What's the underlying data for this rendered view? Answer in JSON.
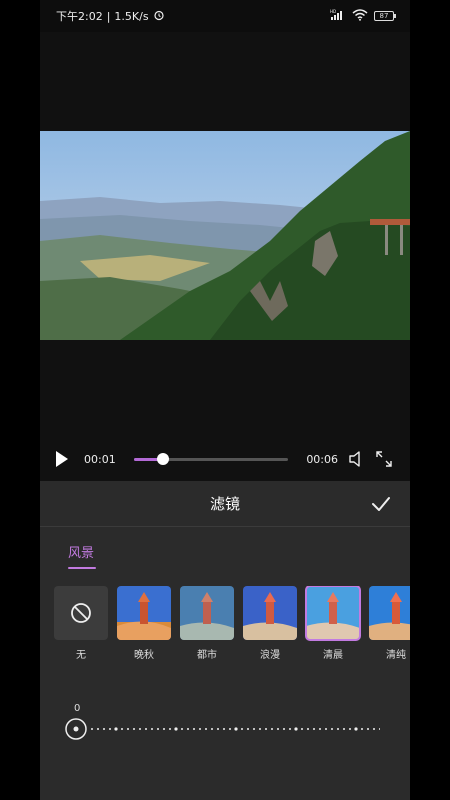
{
  "status_bar": {
    "time": "下午2:02",
    "speed": "1.5K/s",
    "network": "HD",
    "battery": "87"
  },
  "player": {
    "current_time": "00:01",
    "duration": "00:06",
    "progress": 0.19
  },
  "panel": {
    "title": "滤镜",
    "tab": "风景",
    "filters": [
      {
        "label": "无",
        "type": "none"
      },
      {
        "label": "晚秋",
        "type": "warm"
      },
      {
        "label": "都市",
        "type": "city"
      },
      {
        "label": "浪漫",
        "type": "romantic"
      },
      {
        "label": "清晨",
        "type": "morning",
        "selected": true
      },
      {
        "label": "清纯",
        "type": "pure"
      }
    ],
    "intensity": {
      "value": "0"
    }
  },
  "colors": {
    "accent": "#c27be0",
    "panel_bg": "#2b2b2b"
  }
}
